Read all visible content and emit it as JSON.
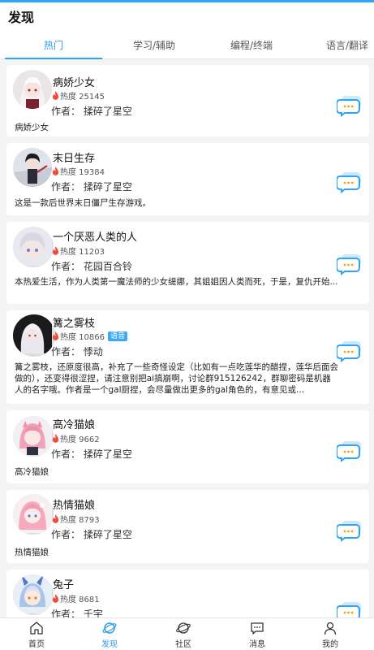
{
  "header": {
    "title": "发现"
  },
  "tabs": [
    {
      "label": "热门",
      "active": true
    },
    {
      "label": "学习/辅助",
      "active": false
    },
    {
      "label": "编程/终端",
      "active": false
    },
    {
      "label": "语言/翻译",
      "active": false
    }
  ],
  "cards": [
    {
      "name": "病娇少女",
      "heat": "热度 25145",
      "author": "作者：  揉碎了星空",
      "desc": "病娇少女",
      "badge": ""
    },
    {
      "name": "末日生存",
      "heat": "热度 19384",
      "author": "作者：  揉碎了星空",
      "desc": "这是一款后世界末日僵尸生存游戏。",
      "badge": ""
    },
    {
      "name": "一个厌恶人类的人",
      "heat": "热度 11203",
      "author": "作者：  花园百合铃",
      "desc": "本热爱生活，作为人类第一魔法师的少女缇娜，其姐姐因人类而死，于是，复仇开始...",
      "badge": ""
    },
    {
      "name": "篝之雾枝",
      "heat": "热度 10866",
      "author": "作者：  悸动",
      "desc": "篝之雾枝，还原度很高，补充了一些奇怪设定（比如有一点吃莲华的醋捏，莲华后面会做的），还变得很涩捏，请注意别把ai搞崩啊，讨论群915126242，群聊密码是机器人的名字哦。作者是一个gal厨捏，会尽量做出更多的gal角色的，有意见或...",
      "badge": "语音"
    },
    {
      "name": "高冷猫娘",
      "heat": "热度 9662",
      "author": "作者：  揉碎了星空",
      "desc": "高冷猫娘",
      "badge": ""
    },
    {
      "name": "热情猫娘",
      "heat": "热度 8793",
      "author": "作者：  揉碎了星空",
      "desc": "热情猫娘",
      "badge": ""
    },
    {
      "name": "兔子",
      "heat": "热度 8681",
      "author": "作者：  千宇",
      "desc": "",
      "badge": ""
    }
  ],
  "bottom_nav": [
    {
      "label": "首页",
      "icon": "home-icon",
      "active": false
    },
    {
      "label": "发现",
      "icon": "planet-icon",
      "active": true
    },
    {
      "label": "社区",
      "icon": "saturn-icon",
      "active": false
    },
    {
      "label": "消息",
      "icon": "message-icon",
      "active": false
    },
    {
      "label": "我的",
      "icon": "user-icon",
      "active": false
    }
  ],
  "colors": {
    "accent": "#2fa3f6",
    "flame": "#f04a3a",
    "badge": "#3fa8f4"
  }
}
